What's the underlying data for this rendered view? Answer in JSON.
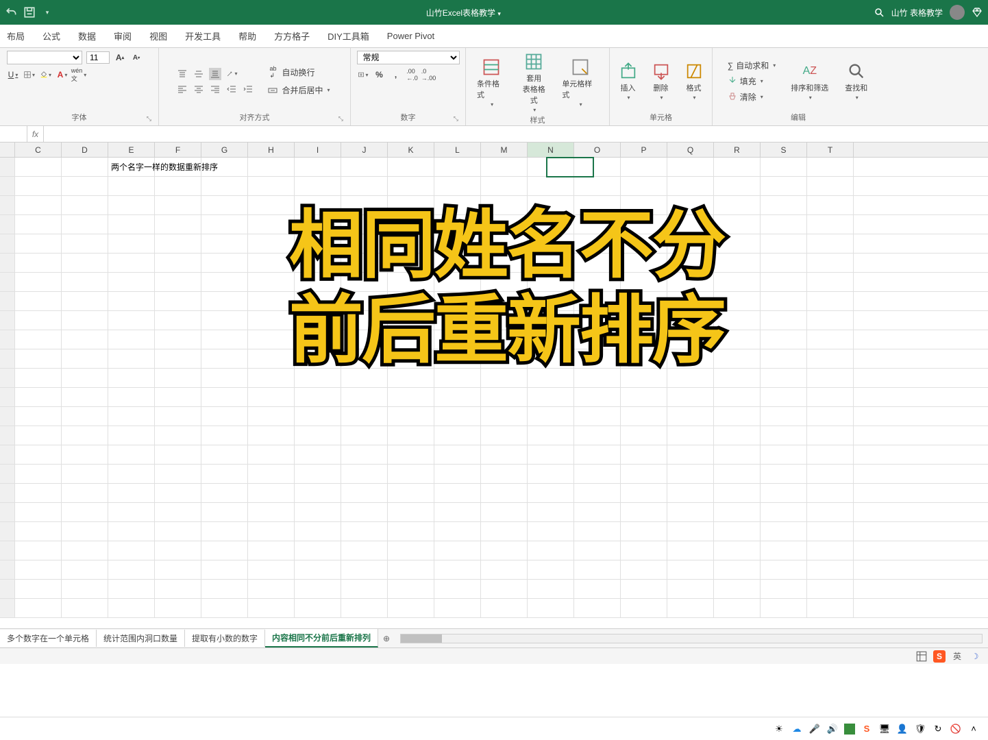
{
  "titlebar": {
    "doc_title": "山竹Excel表格教学",
    "user_name": "山竹 表格教学"
  },
  "tabs": [
    "布局",
    "公式",
    "数据",
    "审阅",
    "视图",
    "开发工具",
    "帮助",
    "方方格子",
    "DIY工具箱",
    "Power Pivot"
  ],
  "ribbon": {
    "font": {
      "size": "11",
      "label": "字体"
    },
    "align": {
      "wrap": "自动换行",
      "merge": "合并后居中",
      "label": "对齐方式"
    },
    "number": {
      "format": "常规",
      "label": "数字"
    },
    "styles": {
      "cond": "条件格式",
      "table": "套用\n表格格式",
      "cell": "单元格样式",
      "label": "样式"
    },
    "cells": {
      "insert": "插入",
      "delete": "删除",
      "format": "格式",
      "label": "单元格"
    },
    "edit": {
      "sum": "自动求和",
      "fill": "填充",
      "clear": "清除",
      "sort": "排序和筛选",
      "find": "查找和",
      "label": "编辑"
    }
  },
  "formula_bar": {
    "fx": "fx"
  },
  "columns": [
    "",
    "C",
    "D",
    "E",
    "F",
    "G",
    "H",
    "I",
    "J",
    "K",
    "L",
    "M",
    "N",
    "O",
    "P",
    "Q",
    "R",
    "S",
    "T"
  ],
  "selected_col_index": 12,
  "cell_text_row1_colE": "两个名字一样的数据重新排序",
  "overlay": {
    "line1": "相同姓名不分",
    "line2": "前后重新排序"
  },
  "sheet_tabs": [
    "多个数字在一个单元格",
    "统计范围内洞口数量",
    "提取有小数的数字",
    "内容相同不分前后重新排列"
  ],
  "active_sheet_index": 3,
  "status": {
    "ime": "S",
    "lang": "英"
  }
}
